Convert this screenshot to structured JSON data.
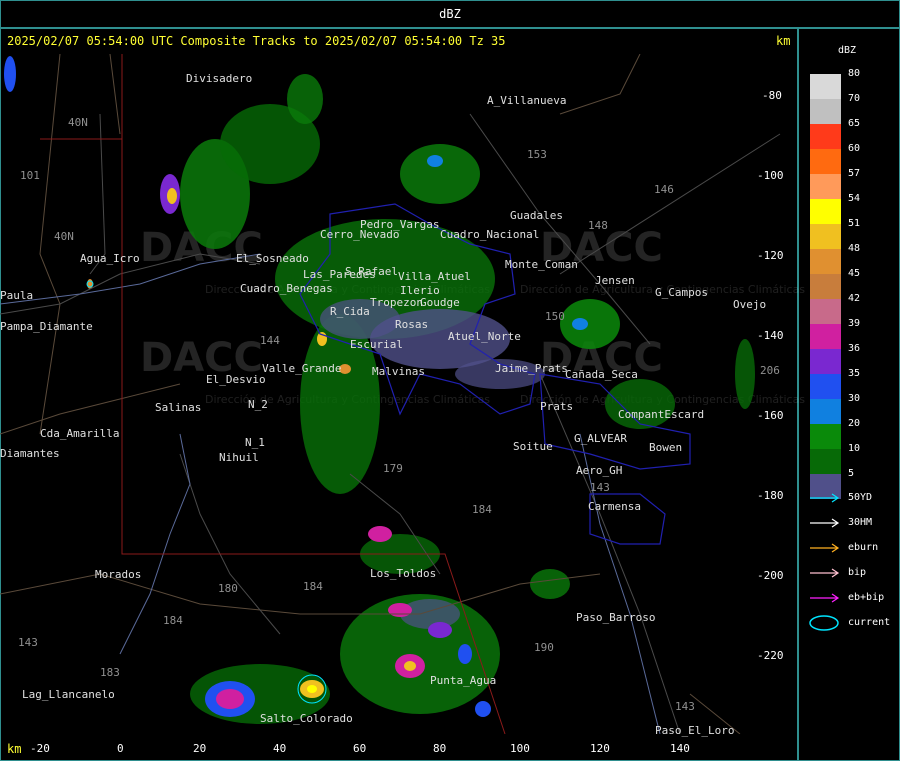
{
  "title_bar": "dBZ",
  "header": "2025/02/07 05:54:00 UTC Composite Tracks to 2025/02/07 05:54:00 Tz 35",
  "km_label": "km",
  "y_axis": [
    "-80",
    "-100",
    "-120",
    "-140",
    "-160",
    "-180",
    "-200",
    "-220"
  ],
  "x_axis": [
    "-20",
    "0",
    "20",
    "40",
    "60",
    "80",
    "100",
    "120",
    "140"
  ],
  "places": [
    "Divisadero",
    "A_Villanueva",
    "Guadales",
    "G_Campos",
    "Ovejo",
    "Agua_Icro",
    "Paula",
    "Pampa_Diamante",
    "El_Desvio",
    "Salinas",
    "N_2",
    "N_1",
    "Nihuil",
    "Cda_Amarilla",
    "Diamantes",
    "Soitue",
    "Aero_GH",
    "Carmensa",
    "Bowen",
    "G_ALVEAR",
    "CompantEscard",
    "Paso_Barroso",
    "Paso_El_Loro",
    "Los_Toldos",
    "Punta_Agua",
    "Morados",
    "Lag_Llancanelo",
    "Valle_Grande",
    "Escurial",
    "Malvinas",
    "Rosas",
    "Cuadro_Nacional",
    "R_Cida",
    "Monte_Coman",
    "Atuel_Norte",
    "Ilerio",
    "Goudge",
    "Tropezon",
    "S_Rafael",
    "Villa_Atuel",
    "Prats",
    "Jaime_Prats",
    "Pedro_Vargas",
    "Jensen",
    "Las_Paredes",
    "El_Sosneado",
    "Cuadro_Benegas",
    "Cañada_Seca",
    "Cerro_Nevado",
    "Salto_Colorado"
  ],
  "routes": [
    "40N",
    "101",
    "40N",
    "153",
    "146",
    "148",
    "144",
    "143",
    "179",
    "184",
    "180",
    "184",
    "190",
    "143",
    "184",
    "183",
    "143",
    "206",
    "150"
  ],
  "watermark": {
    "name": "DACC",
    "sub": "Dirección de Agricultura y Contingencias Climáticas"
  },
  "legend": {
    "title": "dBZ",
    "levels": [
      {
        "label": "80",
        "color": "#d9d9d9"
      },
      {
        "label": "70",
        "color": "#c0c0c0"
      },
      {
        "label": "65",
        "color": "#ff3a1a"
      },
      {
        "label": "60",
        "color": "#ff6a10"
      },
      {
        "label": "57",
        "color": "#ff9a5a"
      },
      {
        "label": "54",
        "color": "#ffff00"
      },
      {
        "label": "51",
        "color": "#f0c020"
      },
      {
        "label": "48",
        "color": "#e09030"
      },
      {
        "label": "45",
        "color": "#c87d3c"
      },
      {
        "label": "42",
        "color": "#c86a8a"
      },
      {
        "label": "39",
        "color": "#d020a0"
      },
      {
        "label": "36",
        "color": "#7a28d0"
      },
      {
        "label": "35",
        "color": "#2050f0"
      },
      {
        "label": "30",
        "color": "#1080e0"
      },
      {
        "label": "20",
        "color": "#0a8a0a"
      },
      {
        "label": "10",
        "color": "#076a07"
      },
      {
        "label": "5",
        "color": "#50508a"
      }
    ],
    "tracks": [
      {
        "label": "50YD",
        "color": "#00e5ff"
      },
      {
        "label": "30HM",
        "color": "#ffffff"
      },
      {
        "label": "eburn",
        "color": "#ffb020"
      },
      {
        "label": "bip",
        "color": "#ffc0d0"
      },
      {
        "label": "eb+bip",
        "color": "#ff20ff"
      },
      {
        "label": "current",
        "color": "#00e5ff"
      }
    ]
  }
}
